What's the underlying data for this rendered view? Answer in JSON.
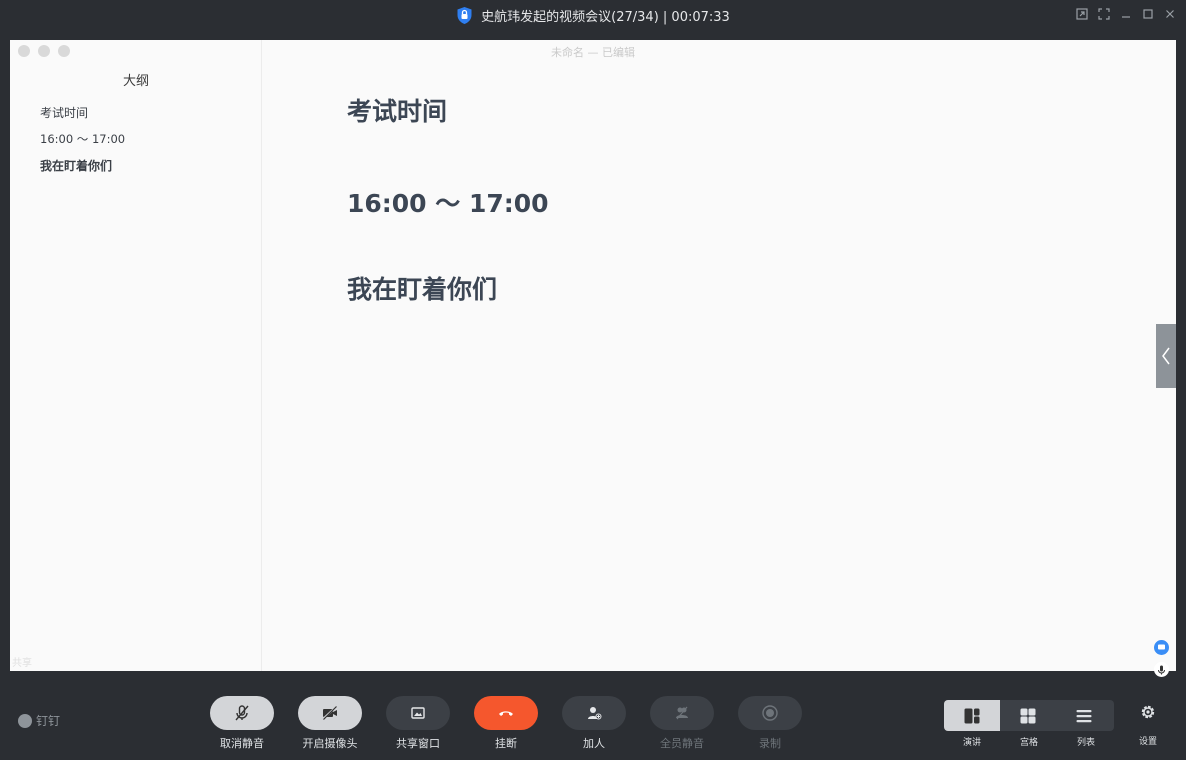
{
  "window": {
    "title": "史航玮发起的视频会议(27/34) | 00:07:33"
  },
  "shared_doc": {
    "title": "未命名 — 已编辑",
    "outline_heading": "大纲",
    "outline_items": [
      "考试时间",
      "16:00 ～ 17:00",
      "我在盯着你们"
    ],
    "headings": [
      "考试时间",
      "16:00 ～ 17:00",
      "我在盯着你们"
    ],
    "overlay_tag": "共享"
  },
  "toolbar": {
    "brand": "钉钉",
    "controls": [
      {
        "label": "取消静音",
        "icon": "mic-off-icon"
      },
      {
        "label": "开启摄像头",
        "icon": "camera-off-icon"
      },
      {
        "label": "共享窗口",
        "icon": "share-window-icon"
      },
      {
        "label": "挂断",
        "icon": "hangup-icon"
      },
      {
        "label": "加人",
        "icon": "add-user-icon"
      },
      {
        "label": "全员静音",
        "icon": "mute-all-icon"
      },
      {
        "label": "录制",
        "icon": "record-icon"
      }
    ],
    "views": [
      {
        "label": "演讲",
        "icon": "speaker-view-icon"
      },
      {
        "label": "宫格",
        "icon": "grid-view-icon"
      },
      {
        "label": "列表",
        "icon": "list-view-icon"
      }
    ],
    "settings_label": "设置"
  },
  "colors": {
    "background": "#2b2e33",
    "hangup": "#f5572d",
    "active_pill": "#d3d5d8"
  }
}
